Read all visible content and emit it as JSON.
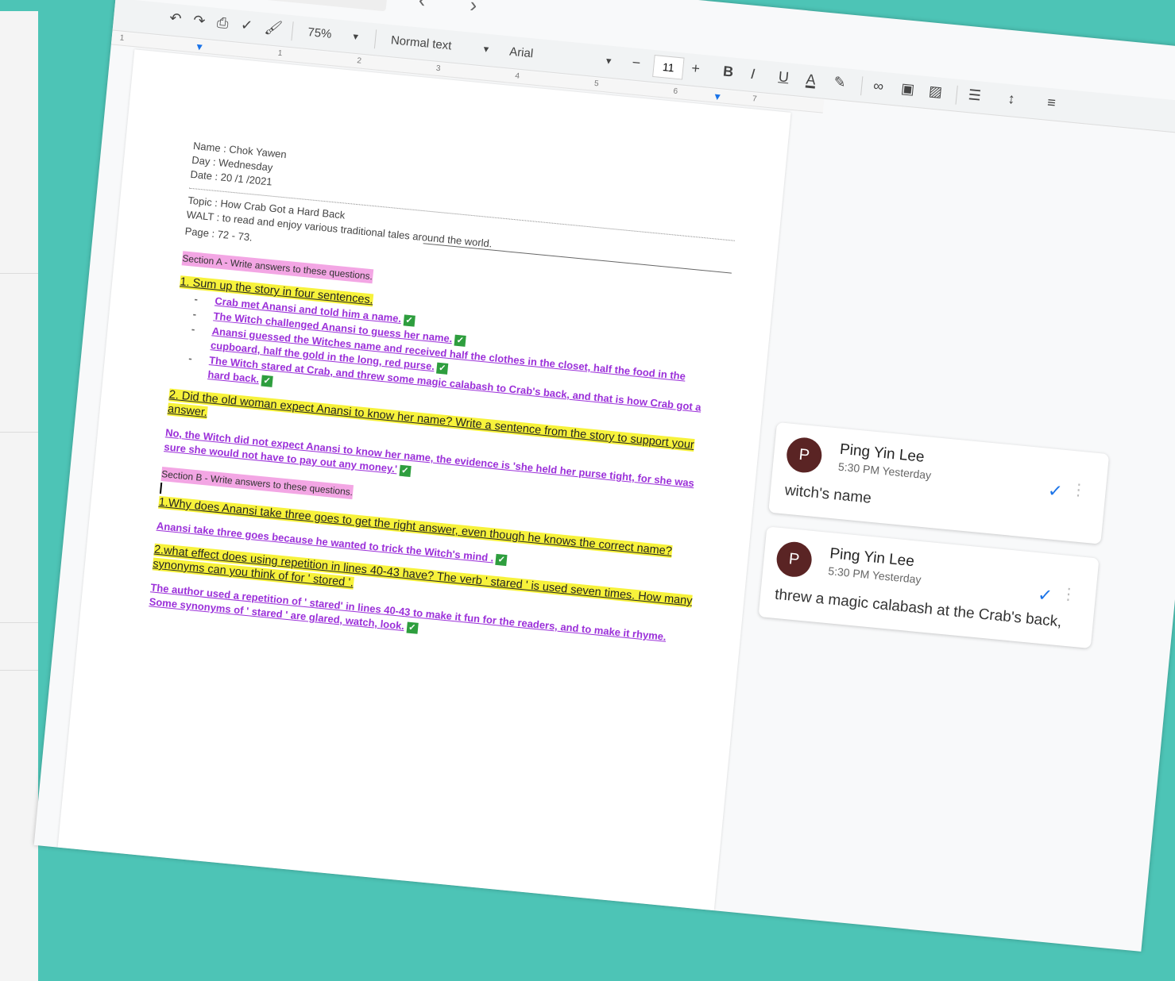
{
  "toolbar": {
    "zoom": "75%",
    "style": "Normal text",
    "font": "Arial",
    "font_size": "11",
    "minus": "−",
    "plus": "+",
    "bold": "B",
    "italic": "I",
    "underline": "U",
    "text_color": "A"
  },
  "ruler": {
    "marks": [
      "1",
      "1",
      "2",
      "3",
      "4",
      "5",
      "6",
      "7"
    ]
  },
  "doc": {
    "name": "Name : Chok Yawen",
    "day": "Day : Wednesday",
    "date": "Date : 20 /1 /2021",
    "topic": "Topic : How Crab Got a Hard Back",
    "walt": "WALT : to read and enjoy various traditional tales around the world.",
    "page": "Page : 72 - 73.",
    "section_a": "Section A -  Write answers to these questions.",
    "q1": "1. Sum up the story in four sentences.",
    "q1_answers": [
      "Crab met Anansi and told him a name.",
      "The Witch challenged Anansi to guess her name.",
      "Anansi guessed the Witches name and received half the clothes in the closet, half the food in the cupboard, half the gold in the long, red purse.",
      "The Witch stared at Crab, and threw some magic calabash to Crab's back, and that is how Crab got a hard back."
    ],
    "q2": "2. Did the old woman expect Anansi to know her name? Write a sentence from the story to support your answer.",
    "a2": "No, the Witch did not expect Anansi to know her name, the evidence is 'she held her purse tight, for she was sure she would not have to pay out any money.'",
    "section_b": "Section B -  Write answers to these questions.",
    "b1": "1.Why does Anansi take three goes to get the right answer, even though he knows the correct name?",
    "b1_answer": "Anansi take three goes because he wanted to trick the Witch's mind .",
    "b2": "2.what effect does using repetition in lines 40-43 have? The verb ' stared ' is used seven times. How many synonyms can you think of for ' stored '.",
    "b2_answer": "The author used a repetition of ' stared'  in lines 40-43 to make it fun for the readers, and to make it rhyme. Some synonyms of ' stared ' are glared, watch, look."
  },
  "comments": [
    {
      "initial": "P",
      "author": "Ping Yin Lee",
      "time": "5:30 PM Yesterday",
      "text": "witch's name"
    },
    {
      "initial": "P",
      "author": "Ping Yin Lee",
      "time": "5:30 PM Yesterday",
      "text": "threw a magic calabash at the Crab's back,"
    }
  ],
  "colors": {
    "background": "#4dc4b6",
    "highlight_yellow": "#f7f23b",
    "highlight_pink": "#f3a6e4",
    "answer_purple": "#9b30d9",
    "avatar": "#5a2424",
    "accent_blue": "#1a73e8"
  }
}
